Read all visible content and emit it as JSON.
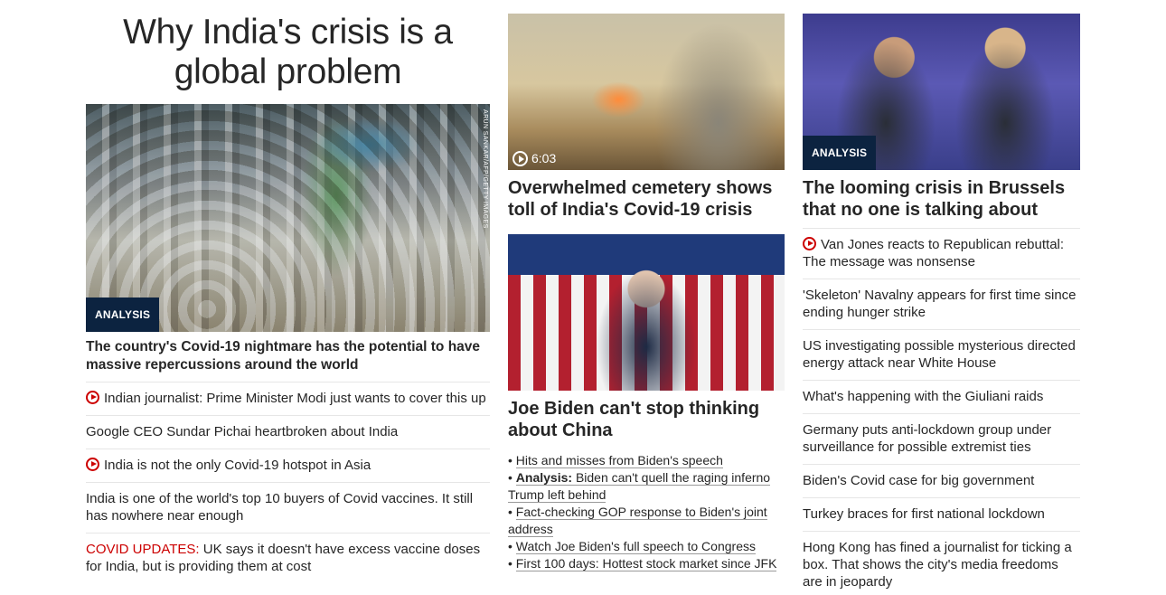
{
  "banner": {
    "title": "Why India's crisis is a global problem"
  },
  "col1": {
    "hero": {
      "label": "ANALYSIS",
      "credit": "ARUN SANKAR/AFP/GETTY IMAGES",
      "headline": "The country's Covid-19 nightmare has the potential to have massive repercussions around the world"
    },
    "items": [
      {
        "text": "Indian journalist: Prime Minister Modi just wants to cover this up",
        "video": true,
        "tag": ""
      },
      {
        "text": "Google CEO Sundar Pichai heartbroken about India",
        "video": false,
        "tag": ""
      },
      {
        "text": "India is not the only Covid-19 hotspot in Asia",
        "video": true,
        "tag": ""
      },
      {
        "text": "India is one of the world's top 10 buyers of Covid vaccines. It still has nowhere near enough",
        "video": false,
        "tag": ""
      },
      {
        "text": "UK says it doesn't have excess vaccine doses for India, but is providing them at cost",
        "video": false,
        "tag": "COVID UPDATES:"
      }
    ]
  },
  "col2": {
    "story1": {
      "duration": "6:03",
      "headline": "Overwhelmed cemetery shows toll of India's Covid-19 crisis"
    },
    "story2": {
      "headline": "Joe Biden can't stop thinking about China",
      "bullets": [
        {
          "prefix": "",
          "text": "Hits and misses from Biden's speech"
        },
        {
          "prefix": "Analysis:",
          "text": "Biden can't quell the raging inferno Trump left behind"
        },
        {
          "prefix": "",
          "text": "Fact-checking GOP response to Biden's joint address"
        },
        {
          "prefix": "",
          "text": "Watch Joe Biden's full speech to Congress"
        },
        {
          "prefix": "",
          "text": "First 100 days: Hottest stock market since JFK"
        }
      ]
    }
  },
  "col3": {
    "story": {
      "label": "ANALYSIS",
      "headline": "The looming crisis in Brussels that no one is talking about"
    },
    "items": [
      {
        "text": "Van Jones reacts to Republican rebuttal: The message was nonsense",
        "video": true
      },
      {
        "text": "'Skeleton' Navalny appears for first time since ending hunger strike",
        "video": false
      },
      {
        "text": "US investigating possible mysterious directed energy attack near White House",
        "video": false
      },
      {
        "text": "What's happening with the Giuliani raids",
        "video": false
      },
      {
        "text": "Germany puts anti-lockdown group under surveillance for possible extremist ties",
        "video": false
      },
      {
        "text": "Biden's Covid case for big government",
        "video": false
      },
      {
        "text": "Turkey braces for first national lockdown",
        "video": false
      },
      {
        "text": "Hong Kong has fined a journalist for ticking a box. That shows the city's media freedoms are in jeopardy",
        "video": false
      }
    ]
  },
  "colors": {
    "label_bg": "#0c2340",
    "accent_red": "#cc0000",
    "text": "#262626",
    "divider": "#e6e6e6"
  },
  "icons": {
    "video": "play-circle-icon"
  }
}
